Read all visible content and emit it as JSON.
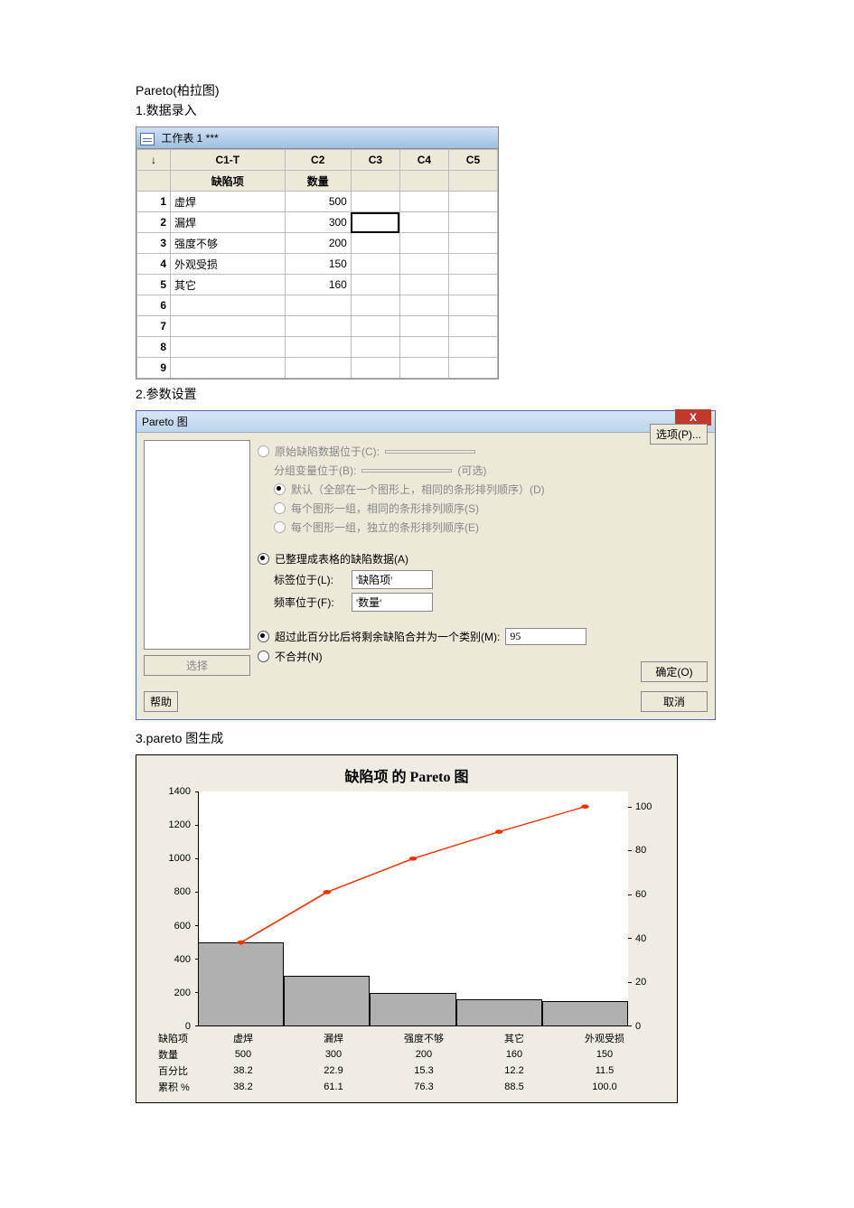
{
  "headings": {
    "title": "Pareto(柏拉图)",
    "sec1": "1.数据录入",
    "sec2": "2.参数设置",
    "sec3": "3.pareto 图生成"
  },
  "worksheet": {
    "title": "工作表 1 ***",
    "columns": [
      "↓",
      "C1-T",
      "C2",
      "C3",
      "C4",
      "C5"
    ],
    "headers": [
      "",
      "缺陷项",
      "数量",
      "",
      "",
      ""
    ],
    "rows": [
      {
        "n": "1",
        "c1": "虚焊",
        "c2": "500"
      },
      {
        "n": "2",
        "c1": "漏焊",
        "c2": "300"
      },
      {
        "n": "3",
        "c1": "强度不够",
        "c2": "200"
      },
      {
        "n": "4",
        "c1": "外观受损",
        "c2": "150"
      },
      {
        "n": "5",
        "c1": "其它",
        "c2": "160"
      },
      {
        "n": "6"
      },
      {
        "n": "7"
      },
      {
        "n": "8"
      },
      {
        "n": "9"
      }
    ]
  },
  "dialog": {
    "title": "Pareto 图",
    "opt_raw": "原始缺陷数据位于(C):",
    "grp_label": "分组变量位于(B):",
    "grp_optional": "(可选)",
    "r1": "默认（全部在一个图形上，相同的条形排列顺序）(D)",
    "r2": "每个图形一组，相同的条形排列顺序(S)",
    "r3": "每个图形一组，独立的条形排列顺序(E)",
    "opt_tab": "已整理成表格的缺陷数据(A)",
    "label_at": "标签位于(L):",
    "label_val": "'缺陷项'",
    "freq_at": "频率位于(F):",
    "freq_val": "'数量'",
    "combine": "超过此百分比后将剩余缺陷合并为一个类别(M):",
    "combine_val": "95",
    "no_combine": "不合并(N)",
    "btn_options": "选项(P)...",
    "btn_select": "选择",
    "btn_help": "帮助",
    "btn_ok": "确定(O)",
    "btn_cancel": "取消"
  },
  "chart_data": {
    "type": "bar",
    "title": "缺陷项 的 Pareto 图",
    "categories": [
      "虚焊",
      "漏焊",
      "强度不够",
      "其它",
      "外观受损"
    ],
    "values": [
      500,
      300,
      200,
      160,
      150
    ],
    "percent": [
      38.2,
      22.9,
      15.3,
      12.2,
      11.5
    ],
    "cumulative_percent": [
      38.2,
      61.1,
      76.3,
      88.5,
      100.0
    ],
    "ylim": [
      0,
      1400
    ],
    "yticks": [
      0,
      200,
      400,
      600,
      800,
      1000,
      1200,
      1400
    ],
    "y2lim": [
      0,
      100
    ],
    "y2ticks": [
      0,
      20,
      40,
      60,
      80,
      100
    ],
    "row_labels": {
      "cat": "缺陷项",
      "cnt": "数量",
      "pct": "百分比",
      "cum": "累积 %"
    }
  }
}
